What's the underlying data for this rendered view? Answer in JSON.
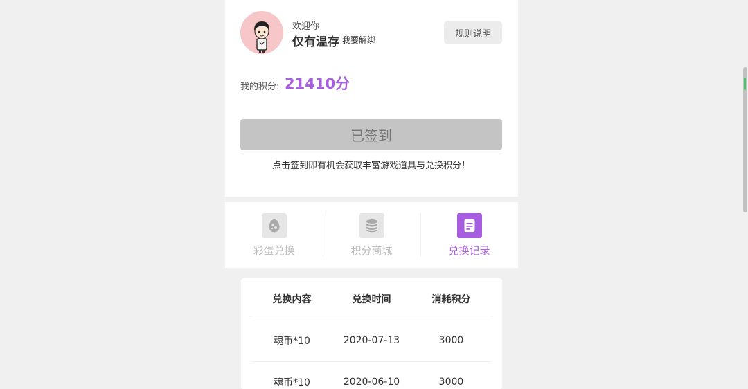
{
  "profile": {
    "welcome": "欢迎你",
    "username": "仅有温存",
    "unbind_link": "我要解绑",
    "rules_button": "规则说明"
  },
  "points": {
    "label": "我的积分:",
    "value": "21410分"
  },
  "signin": {
    "button_label": "已签到",
    "tip": "点击签到即有机会获取丰富游戏道具与兑换积分！"
  },
  "tabs": [
    {
      "label": "彩蛋兑换",
      "icon": "egg-icon",
      "active": false
    },
    {
      "label": "积分商城",
      "icon": "coins-stack-icon",
      "active": false
    },
    {
      "label": "兑换记录",
      "icon": "record-list-icon",
      "active": true
    }
  ],
  "records": {
    "headers": [
      "兑换内容",
      "兑换时间",
      "消耗积分"
    ],
    "rows": [
      [
        "魂币*10",
        "2020-07-13",
        "3000"
      ],
      [
        "魂币*10",
        "2020-06-10",
        "3000"
      ]
    ]
  },
  "colors": {
    "accent": "#a65ddf",
    "signed_button": "#c4c4c4",
    "avatar_bg": "#f6c6c8",
    "page_bg": "#f0f0f0"
  }
}
